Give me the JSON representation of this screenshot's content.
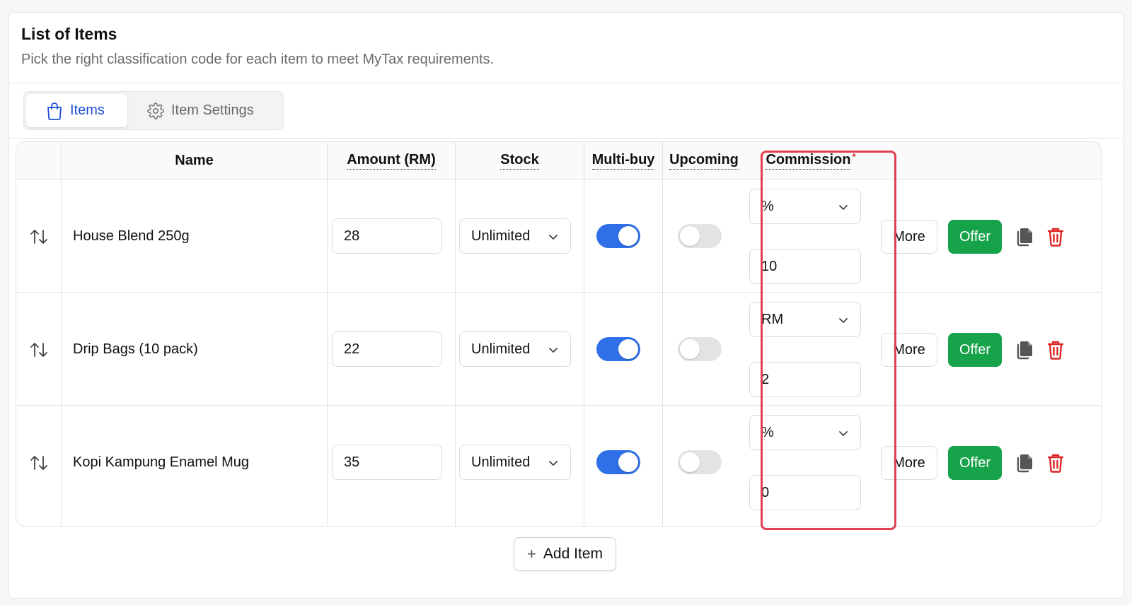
{
  "header": {
    "title": "List of Items",
    "subtitle": "Pick the right classification code for each item to meet MyTax requirements."
  },
  "tabs": [
    {
      "label": "Items",
      "active": true,
      "icon": "shopping-bag-icon"
    },
    {
      "label": "Item Settings",
      "active": false,
      "icon": "gear-icon"
    }
  ],
  "table": {
    "columns": {
      "name": "Name",
      "amount": "Amount (RM)",
      "stock": "Stock",
      "multibuy": "Multi-buy",
      "upcoming": "Upcoming",
      "commission": "Commission",
      "commission_required_mark": "*"
    },
    "rows": [
      {
        "name": "House Blend 250g",
        "amount": "28",
        "stock": "Unlimited",
        "multibuy": true,
        "upcoming": false,
        "commission_type": "%",
        "commission_value": "10",
        "more_label": "More",
        "offer_label": "Offer"
      },
      {
        "name": "Drip Bags (10 pack)",
        "amount": "22",
        "stock": "Unlimited",
        "multibuy": true,
        "upcoming": false,
        "commission_type": "RM",
        "commission_value": "2",
        "more_label": "More",
        "offer_label": "Offer"
      },
      {
        "name": "Kopi Kampung Enamel Mug",
        "amount": "35",
        "stock": "Unlimited",
        "multibuy": true,
        "upcoming": false,
        "commission_type": "%",
        "commission_value": "0",
        "more_label": "More",
        "offer_label": "Offer"
      }
    ]
  },
  "add_item": {
    "label": "Add Item",
    "icon": "plus-icon"
  },
  "colors": {
    "accent": "#1d4ed8",
    "toggle_on": "#2f6fe8",
    "offer_green": "#16a34a",
    "delete_red": "#dc2626",
    "highlight_red": "#e04050"
  }
}
